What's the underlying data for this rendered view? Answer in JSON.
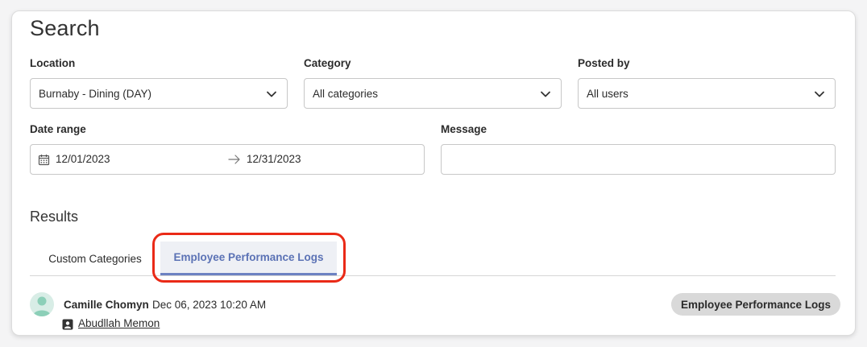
{
  "search": {
    "title": "Search",
    "location": {
      "label": "Location",
      "value": "Burnaby - Dining (DAY)"
    },
    "category": {
      "label": "Category",
      "value": "All categories"
    },
    "posted_by": {
      "label": "Posted by",
      "value": "All users"
    },
    "date_range": {
      "label": "Date range",
      "start": "12/01/2023",
      "end": "12/31/2023"
    },
    "message": {
      "label": "Message",
      "value": ""
    }
  },
  "results": {
    "title": "Results",
    "tabs": [
      {
        "label": "Custom Categories",
        "active": false
      },
      {
        "label": "Employee Performance Logs",
        "active": true
      }
    ],
    "entries": [
      {
        "author": "Camille Chomyn",
        "timestamp": "Dec 06, 2023 10:20 AM",
        "employee": "Abudllah Memon",
        "category_badge": "Employee Performance Logs"
      }
    ]
  },
  "colors": {
    "accent": "#5b72b5",
    "highlight": "#ea2a17",
    "badge_bg": "#d9d9d9"
  },
  "icons": [
    "chevron-down-icon",
    "calendar-icon",
    "arrow-right-icon",
    "user-avatar-icon",
    "employee-badge-icon"
  ]
}
